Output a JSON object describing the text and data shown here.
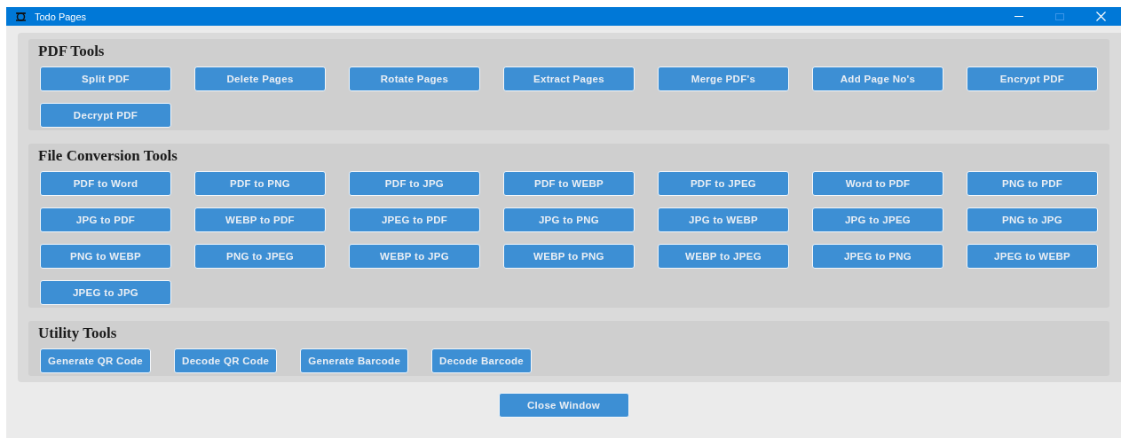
{
  "window": {
    "title": "Todo Pages"
  },
  "sections": [
    {
      "title": "PDF Tools",
      "kind": "grid",
      "buttons": [
        "Split PDF",
        "Delete Pages",
        "Rotate Pages",
        "Extract Pages",
        "Merge PDF's",
        "Add Page No's",
        "Encrypt PDF",
        "Decrypt PDF"
      ]
    },
    {
      "title": "File Conversion Tools",
      "kind": "grid",
      "buttons": [
        "PDF to Word",
        "PDF to PNG",
        "PDF to JPG",
        "PDF to WEBP",
        "PDF to JPEG",
        "Word to PDF",
        "PNG to PDF",
        "JPG to PDF",
        "WEBP to PDF",
        "JPEG to PDF",
        "JPG to PNG",
        "JPG to WEBP",
        "JPG to JPEG",
        "PNG to JPG",
        "PNG to WEBP",
        "PNG to JPEG",
        "WEBP to JPG",
        "WEBP to PNG",
        "WEBP to JPEG",
        "JPEG to PNG",
        "JPEG to WEBP",
        "JPEG to JPG"
      ]
    },
    {
      "title": "Utility Tools",
      "kind": "row",
      "buttons": [
        "Generate QR Code",
        "Decode QR Code",
        "Generate Barcode",
        "Decode Barcode"
      ]
    }
  ],
  "footer": {
    "button": "Close Window"
  }
}
